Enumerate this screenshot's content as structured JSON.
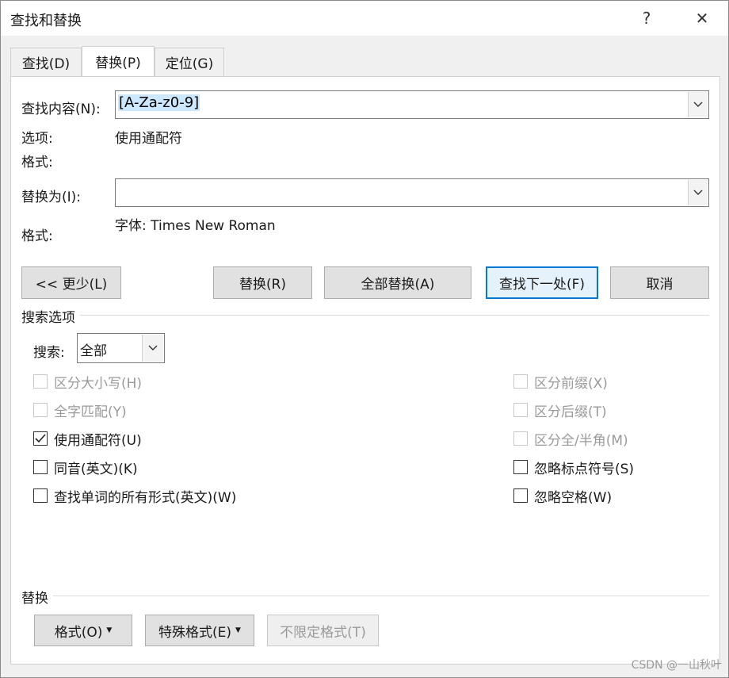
{
  "window": {
    "title": "查找和替换",
    "help_label": "?",
    "close_label": "✕"
  },
  "tabs": [
    {
      "label": "查找(D)",
      "active": false
    },
    {
      "label": "替换(P)",
      "active": true
    },
    {
      "label": "定位(G)",
      "active": false
    }
  ],
  "find": {
    "label": "查找内容(N):",
    "value": "[A-Za-z0-9]",
    "options_label": "选项:",
    "options_value": "使用通配符",
    "format_label": "格式:",
    "format_value": ""
  },
  "replace": {
    "label": "替换为(I):",
    "value": "",
    "format_label": "格式:",
    "format_value": "字体: Times New Roman"
  },
  "buttons": {
    "less": "<< 更少(L)",
    "replace": "替换(R)",
    "replace_all": "全部替换(A)",
    "find_next": "查找下一处(F)",
    "cancel": "取消"
  },
  "search_options": {
    "title": "搜索选项",
    "search_label": "搜索:",
    "search_value": "全部",
    "left": [
      {
        "label": "区分大小写(H)",
        "checked": false,
        "disabled": true
      },
      {
        "label": "全字匹配(Y)",
        "checked": false,
        "disabled": true
      },
      {
        "label": "使用通配符(U)",
        "checked": true,
        "disabled": false
      },
      {
        "label": "同音(英文)(K)",
        "checked": false,
        "disabled": false
      },
      {
        "label": "查找单词的所有形式(英文)(W)",
        "checked": false,
        "disabled": false
      }
    ],
    "right": [
      {
        "label": "区分前缀(X)",
        "checked": false,
        "disabled": true
      },
      {
        "label": "区分后缀(T)",
        "checked": false,
        "disabled": true
      },
      {
        "label": "区分全/半角(M)",
        "checked": false,
        "disabled": true
      },
      {
        "label": "忽略标点符号(S)",
        "checked": false,
        "disabled": false
      },
      {
        "label": "忽略空格(W)",
        "checked": false,
        "disabled": false
      }
    ]
  },
  "replace_section": {
    "title": "替换",
    "format_button": "格式(O)",
    "special_button": "特殊格式(E)",
    "no_format_button": "不限定格式(T)"
  },
  "watermark": "CSDN @一山秋叶"
}
